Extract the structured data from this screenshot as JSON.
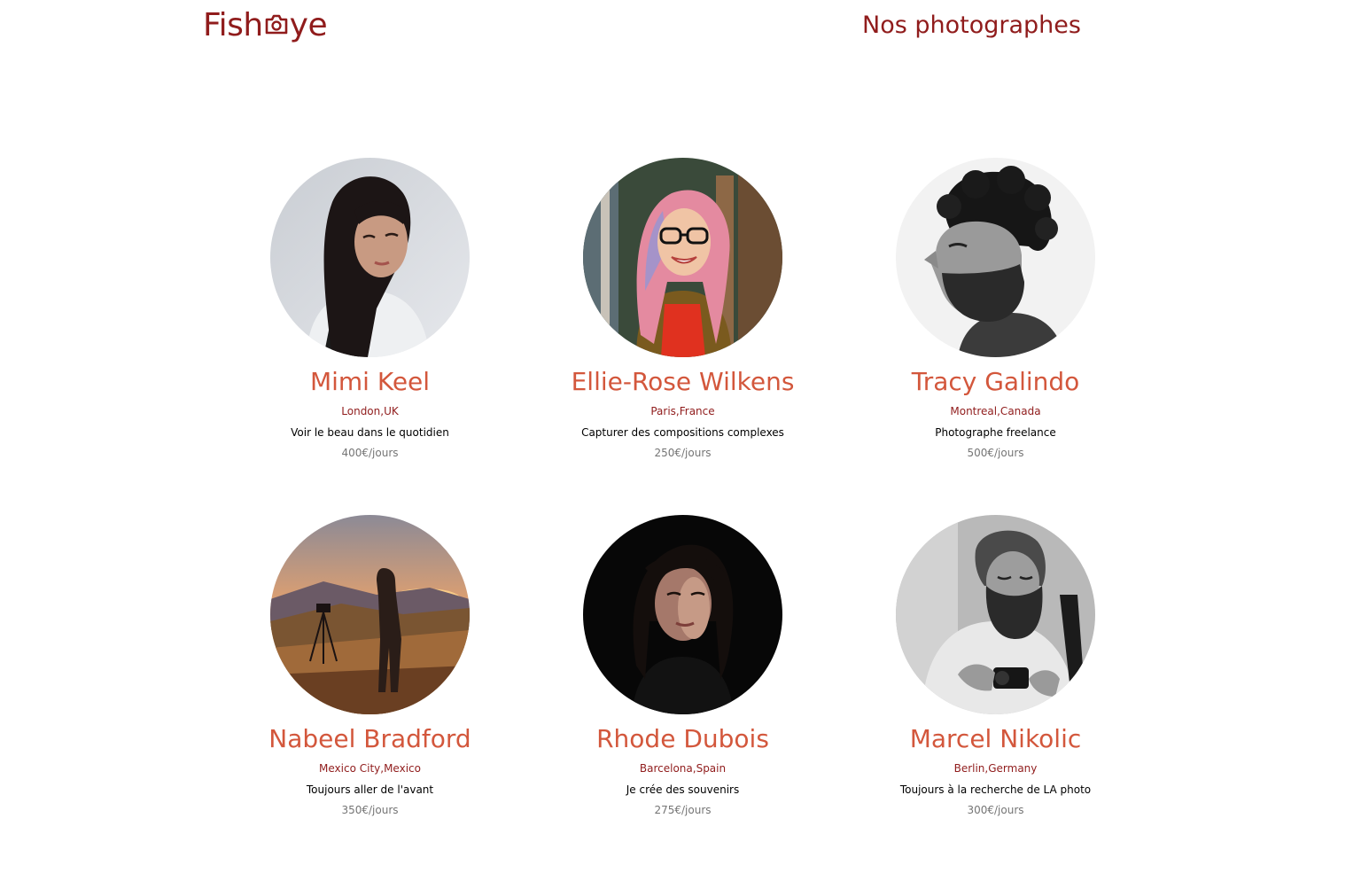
{
  "header": {
    "logo_text_left": "Fish",
    "logo_text_right": "ye",
    "page_title": "Nos photographes"
  },
  "colors": {
    "brand": "#901C1C",
    "accent": "#D3573C",
    "text": "#000000",
    "price": "#757575"
  },
  "photographers": [
    {
      "name": "Mimi Keel",
      "location": "London,UK",
      "tagline": "Voir le beau dans le quotidien",
      "price": "400€/jours",
      "photo_icon": "portrait-young-woman-dark-hair"
    },
    {
      "name": "Ellie-Rose Wilkens",
      "location": "Paris,France",
      "tagline": "Capturer des compositions complexes",
      "price": "250€/jours",
      "photo_icon": "portrait-woman-glasses-pink-hair"
    },
    {
      "name": "Tracy Galindo",
      "location": "Montreal,Canada",
      "tagline": "Photographe freelance",
      "price": "500€/jours",
      "photo_icon": "portrait-bearded-man-curly-hair-bw"
    },
    {
      "name": "Nabeel Bradford",
      "location": "Mexico City,Mexico",
      "tagline": "Toujours aller de l'avant",
      "price": "350€/jours",
      "photo_icon": "portrait-photographer-sunset-landscape"
    },
    {
      "name": "Rhode Dubois",
      "location": "Barcelona,Spain",
      "tagline": "Je crée des souvenirs",
      "price": "275€/jours",
      "photo_icon": "portrait-woman-dark-background"
    },
    {
      "name": "Marcel Nikolic",
      "location": "Berlin,Germany",
      "tagline": "Toujours à la recherche de LA photo",
      "price": "300€/jours",
      "photo_icon": "portrait-bearded-man-camera-bw"
    }
  ]
}
